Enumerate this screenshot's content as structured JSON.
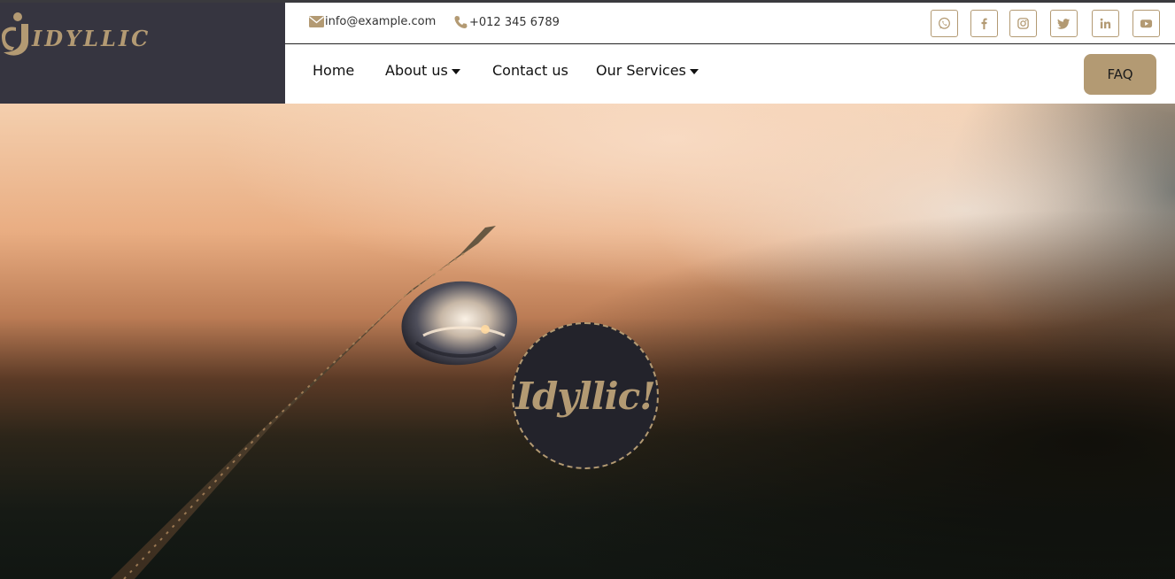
{
  "brand": {
    "logo_text": "IDYLLIC",
    "accent_color": "#b39a73",
    "panel_color": "#363540"
  },
  "topbar": {
    "email": "info@example.com",
    "email_icon": "envelope-icon",
    "phone": "+012 345 6789",
    "phone_icon": "phone-icon",
    "socials": [
      {
        "name": "whatsapp",
        "icon": "whatsapp-icon"
      },
      {
        "name": "facebook",
        "icon": "facebook-icon"
      },
      {
        "name": "instagram",
        "icon": "instagram-icon"
      },
      {
        "name": "twitter",
        "icon": "twitter-icon"
      },
      {
        "name": "linkedin",
        "icon": "linkedin-icon"
      },
      {
        "name": "youtube",
        "icon": "youtube-icon"
      }
    ]
  },
  "nav": {
    "items": [
      {
        "label": "Home",
        "dropdown": false
      },
      {
        "label": "About us",
        "dropdown": true
      },
      {
        "label": "Contact us",
        "dropdown": false
      },
      {
        "label": "Our Services",
        "dropdown": true
      }
    ],
    "faq_label": "FAQ"
  },
  "hero": {
    "badge_text": "Idyllic!",
    "image_description_icon": "water-droplet-photo"
  }
}
